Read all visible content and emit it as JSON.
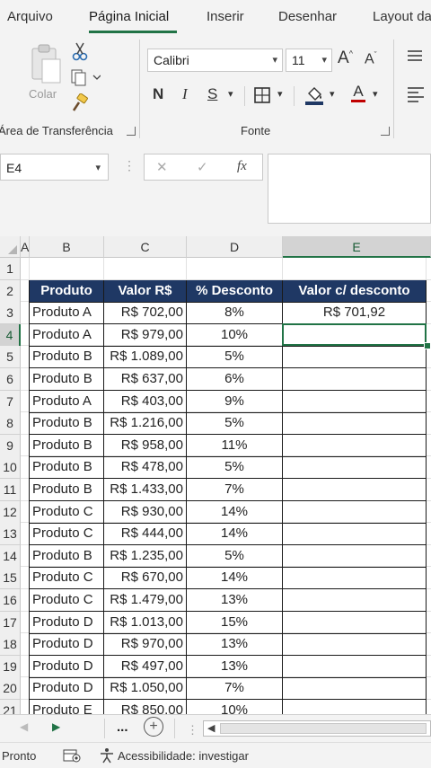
{
  "tabs": [
    "Arquivo",
    "Página Inicial",
    "Inserir",
    "Desenhar",
    "Layout da"
  ],
  "ribbon": {
    "clipboard_label": "Área de Transferência",
    "paste_label": "Colar",
    "font_label": "Fonte",
    "font_name": "Calibri",
    "font_size": "11",
    "grow_font": "A",
    "shrink_font": "A",
    "bold": "N",
    "italic": "I",
    "underline": "S",
    "font_color_glyph": "A"
  },
  "formula_bar": {
    "name_box": "E4",
    "cancel_glyph": "✕",
    "enter_glyph": "✓",
    "fx_glyph": "fx",
    "formula": ""
  },
  "sheet": {
    "columns": [
      "A",
      "B",
      "C",
      "D",
      "E"
    ],
    "selected_column": "E",
    "selected_row": "4",
    "headers": [
      "Produto",
      "Valor R$",
      "% Desconto",
      "Valor c/ desconto"
    ],
    "rows": [
      {
        "num": "3",
        "produto": "Produto A",
        "valor": "R$ 702,00",
        "desconto": "8%",
        "final": "R$ 701,92"
      },
      {
        "num": "4",
        "produto": "Produto A",
        "valor": "R$ 979,00",
        "desconto": "10%",
        "final": ""
      },
      {
        "num": "5",
        "produto": "Produto B",
        "valor": "R$ 1.089,00",
        "desconto": "5%",
        "final": ""
      },
      {
        "num": "6",
        "produto": "Produto B",
        "valor": "R$ 637,00",
        "desconto": "6%",
        "final": ""
      },
      {
        "num": "7",
        "produto": "Produto A",
        "valor": "R$ 403,00",
        "desconto": "9%",
        "final": ""
      },
      {
        "num": "8",
        "produto": "Produto B",
        "valor": "R$ 1.216,00",
        "desconto": "5%",
        "final": ""
      },
      {
        "num": "9",
        "produto": "Produto B",
        "valor": "R$ 958,00",
        "desconto": "11%",
        "final": ""
      },
      {
        "num": "10",
        "produto": "Produto B",
        "valor": "R$ 478,00",
        "desconto": "5%",
        "final": ""
      },
      {
        "num": "11",
        "produto": "Produto B",
        "valor": "R$ 1.433,00",
        "desconto": "7%",
        "final": ""
      },
      {
        "num": "12",
        "produto": "Produto C",
        "valor": "R$ 930,00",
        "desconto": "14%",
        "final": ""
      },
      {
        "num": "13",
        "produto": "Produto C",
        "valor": "R$ 444,00",
        "desconto": "14%",
        "final": ""
      },
      {
        "num": "14",
        "produto": "Produto B",
        "valor": "R$ 1.235,00",
        "desconto": "5%",
        "final": ""
      },
      {
        "num": "15",
        "produto": "Produto C",
        "valor": "R$ 670,00",
        "desconto": "14%",
        "final": ""
      },
      {
        "num": "16",
        "produto": "Produto C",
        "valor": "R$ 1.479,00",
        "desconto": "13%",
        "final": ""
      },
      {
        "num": "17",
        "produto": "Produto D",
        "valor": "R$ 1.013,00",
        "desconto": "15%",
        "final": ""
      },
      {
        "num": "18",
        "produto": "Produto D",
        "valor": "R$ 970,00",
        "desconto": "13%",
        "final": ""
      },
      {
        "num": "19",
        "produto": "Produto D",
        "valor": "R$ 497,00",
        "desconto": "13%",
        "final": ""
      },
      {
        "num": "20",
        "produto": "Produto D",
        "valor": "R$ 1.050,00",
        "desconto": "7%",
        "final": ""
      },
      {
        "num": "21",
        "produto": "Produto E",
        "valor": "R$ 850,00",
        "desconto": "10%",
        "final": ""
      }
    ]
  },
  "sheetbar": {
    "more": "...",
    "add": "+"
  },
  "status": {
    "ready": "Pronto",
    "accessibility": "Acessibilidade: investigar"
  },
  "colors": {
    "accent": "#217346",
    "header_fill": "#1f3864"
  }
}
